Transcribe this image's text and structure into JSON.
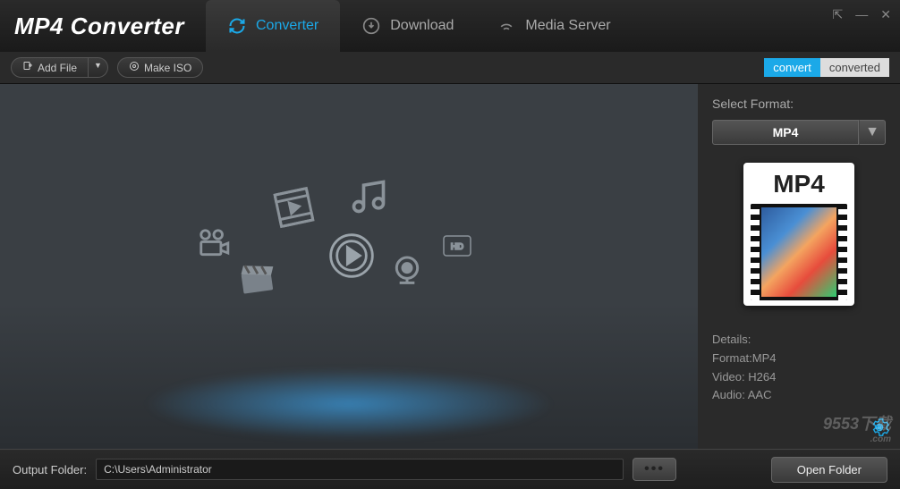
{
  "app": {
    "title": "MP4 Converter"
  },
  "window_controls": {
    "popout": "⇱",
    "minimize": "—",
    "close": "✕"
  },
  "tabs": [
    {
      "label": "Converter",
      "active": true
    },
    {
      "label": "Download",
      "active": false
    },
    {
      "label": "Media Server",
      "active": false
    }
  ],
  "toolbar": {
    "add_file": "Add File",
    "make_iso": "Make ISO",
    "convert_tab": "convert",
    "converted_tab": "converted"
  },
  "sidebar": {
    "select_label": "Select Format:",
    "selected_format": "MP4",
    "preview_label": "MP4",
    "details_heading": "Details:",
    "format_line": "Format:MP4",
    "video_line": "Video: H264",
    "audio_line": "Audio: AAC"
  },
  "bottom": {
    "label": "Output Folder:",
    "path": "C:\\Users\\Administrator",
    "browse": "•••",
    "open_folder": "Open Folder"
  },
  "watermark": {
    "main": "9553下载",
    "sub": ".com"
  }
}
